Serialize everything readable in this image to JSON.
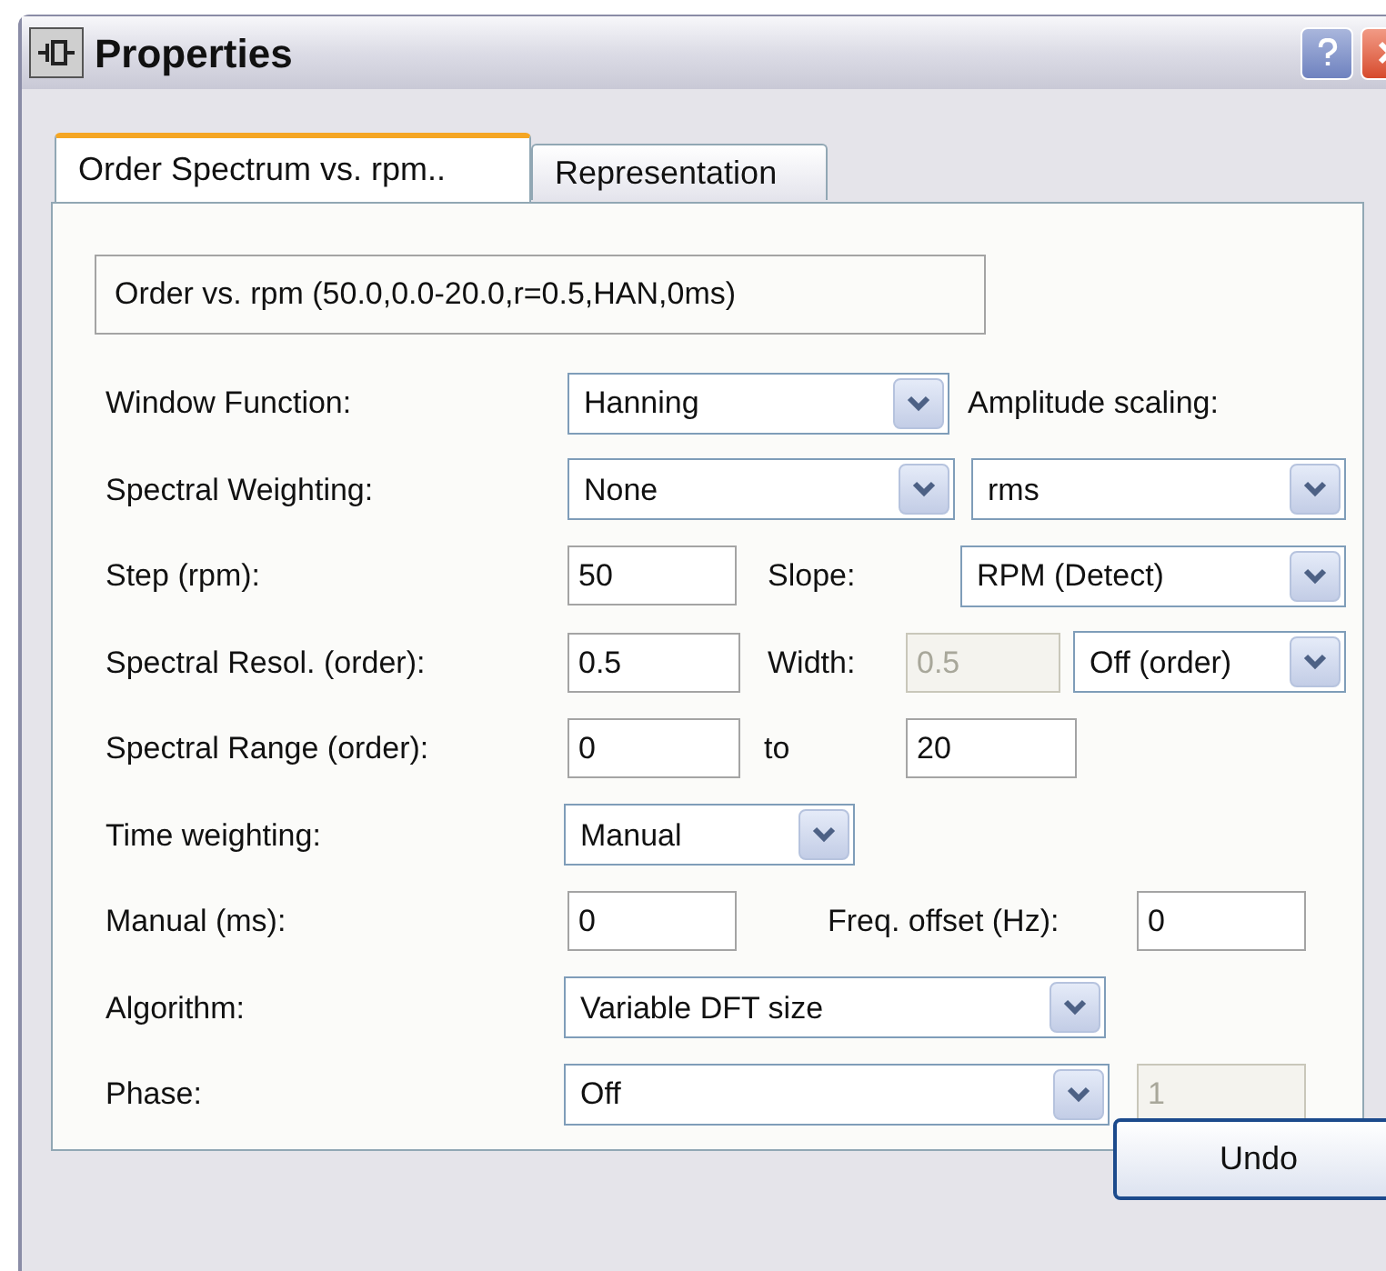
{
  "window": {
    "title": "Properties"
  },
  "tabs": [
    {
      "label": "Order Spectrum vs. rpm..",
      "selected": true
    },
    {
      "label": "Representation",
      "selected": false
    }
  ],
  "summary": "Order vs. rpm (50.0,0.0-20.0,r=0.5,HAN,0ms)",
  "rows": [
    {
      "items": [
        {
          "kind": "label",
          "text": "Window Function:"
        },
        {
          "kind": "combo",
          "value": "Hanning"
        },
        {
          "kind": "label",
          "text": "Amplitude scaling:"
        }
      ]
    },
    {
      "items": [
        {
          "kind": "label",
          "text": "Spectral Weighting:"
        },
        {
          "kind": "combo",
          "value": "None"
        },
        {
          "kind": "combo",
          "value": "rms"
        }
      ]
    },
    {
      "items": [
        {
          "kind": "label",
          "text": "Step (rpm):"
        },
        {
          "kind": "field",
          "value": "50",
          "disabled": false
        },
        {
          "kind": "label",
          "text": "Slope:"
        },
        {
          "kind": "combo",
          "value": "RPM (Detect)"
        }
      ]
    },
    {
      "items": [
        {
          "kind": "label",
          "text": "Spectral Resol. (order):"
        },
        {
          "kind": "field",
          "value": "0.5",
          "disabled": false
        },
        {
          "kind": "label",
          "text": "Width:"
        },
        {
          "kind": "field",
          "value": "0.5",
          "disabled": true
        },
        {
          "kind": "combo",
          "value": "Off (order)"
        }
      ]
    },
    {
      "items": [
        {
          "kind": "label",
          "text": "Spectral Range (order):"
        },
        {
          "kind": "field",
          "value": "0",
          "disabled": false
        },
        {
          "kind": "label",
          "text": "to"
        },
        {
          "kind": "field",
          "value": "20",
          "disabled": false
        }
      ]
    },
    {
      "items": [
        {
          "kind": "label",
          "text": "Time weighting:"
        },
        {
          "kind": "combo",
          "value": "Manual"
        }
      ]
    },
    {
      "items": [
        {
          "kind": "label",
          "text": "Manual (ms):"
        },
        {
          "kind": "field",
          "value": "0",
          "disabled": false
        },
        {
          "kind": "label",
          "text": "Freq. offset (Hz):"
        },
        {
          "kind": "field",
          "value": "0",
          "disabled": false
        }
      ]
    },
    {
      "items": [
        {
          "kind": "label",
          "text": "Algorithm:"
        },
        {
          "kind": "combo",
          "value": "Variable DFT size"
        }
      ]
    },
    {
      "items": [
        {
          "kind": "label",
          "text": "Phase:"
        },
        {
          "kind": "combo",
          "value": "Off"
        },
        {
          "kind": "field",
          "value": "1",
          "disabled": true
        }
      ]
    }
  ],
  "buttons": [
    {
      "label": "Undo"
    }
  ]
}
